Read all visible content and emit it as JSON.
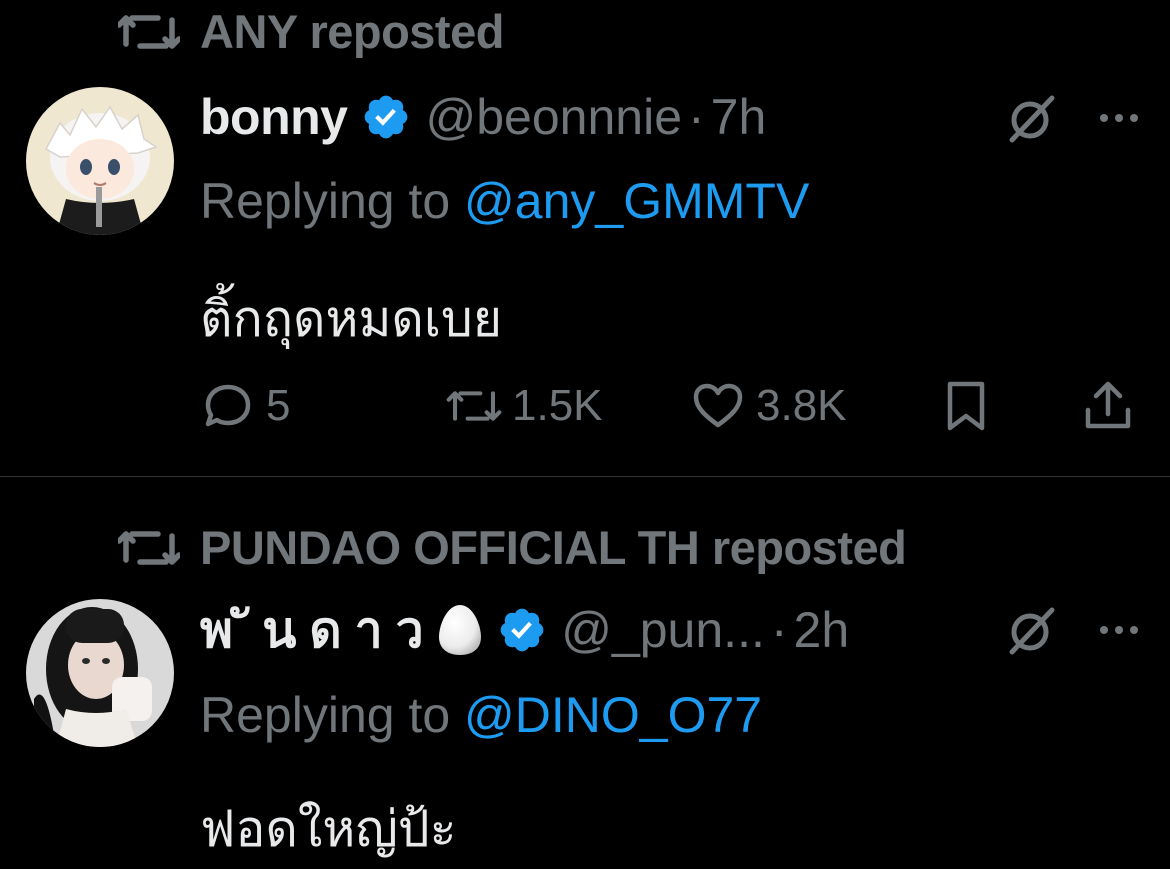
{
  "tweets": [
    {
      "reposted_by": "ANY reposted",
      "display_name": "bonny",
      "verified": true,
      "handle": "@beonnnie",
      "separator": "·",
      "time": "7h",
      "replying_prefix": "Replying to ",
      "replying_to": "@any_GMMTV",
      "text": "ติ้กถุดหมดเบย",
      "stats": {
        "replies": "5",
        "reposts": "1.5K",
        "likes": "3.8K"
      }
    },
    {
      "reposted_by": "PUNDAO OFFICIAL TH reposted",
      "display_name": "พ ั น ด า ว",
      "emoji": "egg",
      "verified": true,
      "handle": "@_pun...",
      "separator": "·",
      "time": "2h",
      "replying_prefix": "Replying to ",
      "replying_to": "@DINO_O77",
      "text": "ฟอดใหญ่ป้ะ"
    }
  ],
  "colors": {
    "background": "#000000",
    "text": "#e7e9ea",
    "muted": "#71767b",
    "link": "#1d9bf0",
    "verified": "#1d9bf0",
    "divider": "#2f3336"
  },
  "icons": [
    "repost-icon",
    "verified-badge-icon",
    "grok-icon",
    "more-icon",
    "reply-icon",
    "like-icon",
    "bookmark-icon",
    "share-icon",
    "egg-icon"
  ]
}
